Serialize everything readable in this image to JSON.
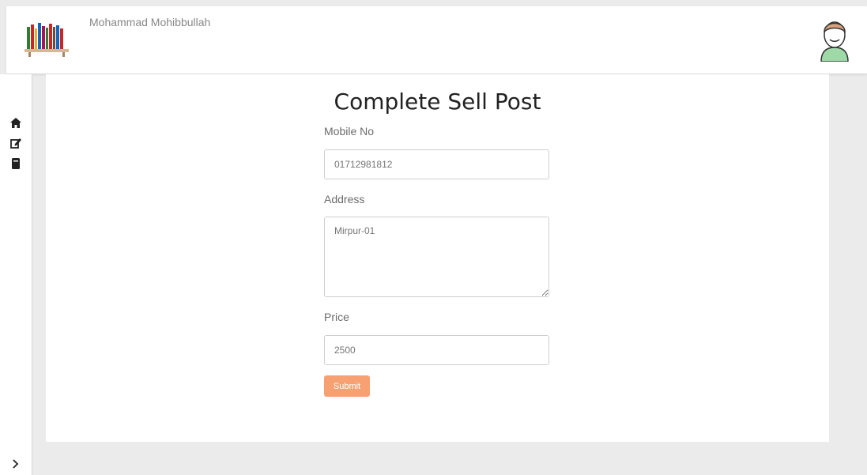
{
  "header": {
    "user_name": "Mohammad Mohibbullah",
    "logo_icon": "bookshelf-icon",
    "avatar_icon": "user-avatar-icon"
  },
  "sidebar": {
    "items": [
      {
        "icon": "home-icon"
      },
      {
        "icon": "edit-icon"
      },
      {
        "icon": "book-icon"
      }
    ],
    "toggle_icon": "chevron-right-icon"
  },
  "form": {
    "title": "Complete Sell Post",
    "mobile_label": "Mobile No",
    "mobile_placeholder": "01712981812",
    "address_label": "Address",
    "address_placeholder": "Mirpur-01",
    "price_label": "Price",
    "price_placeholder": "2500",
    "submit_label": "Submit"
  },
  "colors": {
    "accent": "#f7a173",
    "background": "#ebebeb"
  }
}
